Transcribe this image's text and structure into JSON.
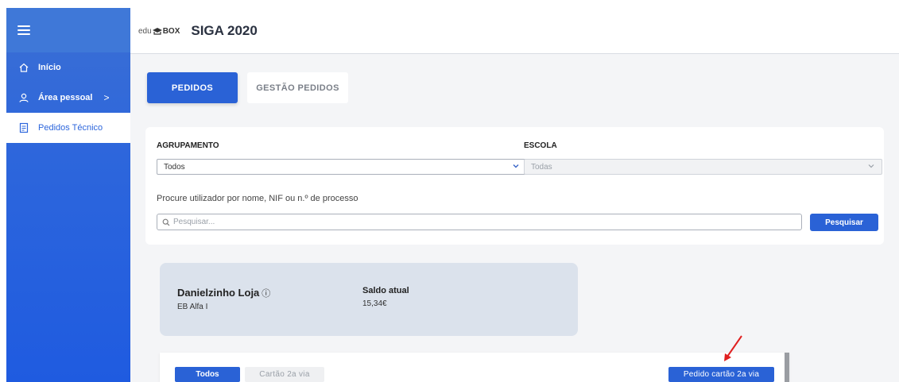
{
  "sidebar": {
    "items": [
      {
        "label": "Início",
        "icon": "home-icon"
      },
      {
        "label": "Área pessoal",
        "icon": "user-icon",
        "chevron": ">"
      },
      {
        "label": "Pedidos Técnico",
        "icon": "clipboard-icon"
      }
    ]
  },
  "header": {
    "logo_prefix": "edu",
    "logo_suffix": "BOX",
    "title": "SIGA 2020"
  },
  "tabs": {
    "pedidos": "PEDIDOS",
    "gestao": "GESTÃO PEDIDOS"
  },
  "filters": {
    "agrupamento_label": "AGRUPAMENTO",
    "agrupamento_value": "Todos",
    "escola_label": "ESCOLA",
    "escola_value": "Todas",
    "search_hint": "Procure utilizador por nome, NIF ou n.º de processo",
    "search_placeholder": "Pesquisar...",
    "search_button": "Pesquisar"
  },
  "user": {
    "name": "Danielzinho Loja",
    "info_glyph": "ⓘ",
    "school": "EB Alfa I",
    "balance_label": "Saldo atual",
    "balance_value": "15,34€"
  },
  "orders": {
    "tab_all": "Todos",
    "tab_card": "Cartão 2a via",
    "new_request_button": "Pedido cartão 2a via"
  },
  "colors": {
    "primary": "#2a62d6",
    "sidebar": "#2d66dc",
    "user_card": "#dbe2ec",
    "annotation": "#e02020"
  }
}
